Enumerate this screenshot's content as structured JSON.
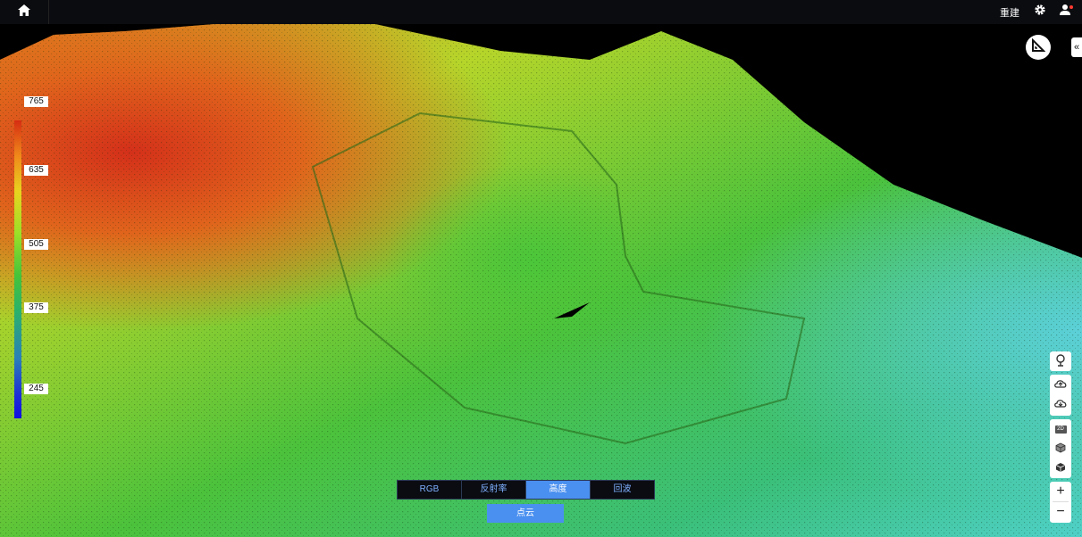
{
  "topbar": {
    "home_icon": "home-icon",
    "rebuild_label": "重建",
    "settings_icon": "gear-icon",
    "user_icon": "user-icon"
  },
  "legend": {
    "labels": [
      "765",
      "635",
      "505",
      "375",
      "245"
    ],
    "colors": [
      "#d62d12",
      "#e8d41f",
      "#45c43a",
      "#2a7fb8",
      "#1010e0"
    ]
  },
  "right_panel": {
    "measure_icon": "ruler-triangle-icon",
    "collapse_glyph": "«",
    "tools": [
      "tree-icon",
      "cloud-up-icon",
      "cloud-down-icon"
    ],
    "view_label_2d": "2D",
    "view_icons": [
      "cube-outline-icon",
      "cube-solid-icon"
    ],
    "zoom_in": "+",
    "zoom_out": "−"
  },
  "modes": {
    "rgb": "RGB",
    "reflectance": "反射率",
    "height": "高度",
    "echo": "回波",
    "active": "高度"
  },
  "pointcloud_label": "点云"
}
